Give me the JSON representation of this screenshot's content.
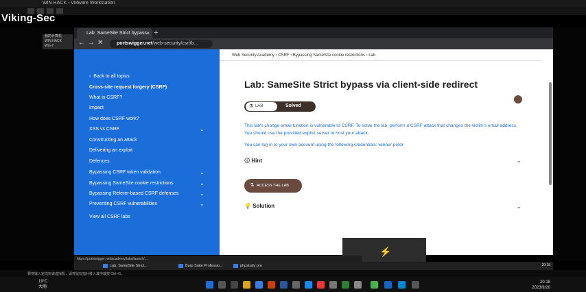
{
  "vm": {
    "title": "WIN HACK - VMware Workstation",
    "watermark": "Viking-Sec",
    "tree_items": [
      "我的计算机",
      "WIN HACK",
      "Win-7"
    ],
    "status_text": "要将输入定向到该虚拟机，请将鼠标指针移入其中或按 Ctrl+G。"
  },
  "browser": {
    "tab_title": "Lab: SameSite Strict bypass",
    "new_tab": "+",
    "close_tab": "×",
    "url_domain": "portswigger.net",
    "url_path": "/web-security/csrf/b…",
    "status_url": "https://portswigger.net/academy/labs/launch/..."
  },
  "sidebar": {
    "back": "Back to all topics",
    "items": [
      {
        "label": "Cross-site request forgery (CSRF)",
        "bold": true,
        "chev": false
      },
      {
        "label": "What is CSRF?",
        "bold": false,
        "chev": false
      },
      {
        "label": "Impact",
        "bold": false,
        "chev": false
      },
      {
        "label": "How does CSRF work?",
        "bold": false,
        "chev": false
      },
      {
        "label": "XSS vs CSRF",
        "bold": false,
        "chev": true
      },
      {
        "label": "Constructing an attack",
        "bold": false,
        "chev": false
      },
      {
        "label": "Delivering an exploit",
        "bold": false,
        "chev": false
      },
      {
        "label": "Defences",
        "bold": false,
        "chev": false
      },
      {
        "label": "Bypassing CSRF token validation",
        "bold": false,
        "chev": true
      },
      {
        "label": "Bypassing SameSite cookie restrictions",
        "bold": false,
        "chev": true
      },
      {
        "label": "Bypassing Referer-based CSRF defenses",
        "bold": false,
        "chev": true
      },
      {
        "label": "Preventing CSRF vulnerabilities",
        "bold": false,
        "chev": true
      },
      {
        "label": "View all CSRF labs",
        "bold": false,
        "chev": false
      }
    ]
  },
  "content": {
    "breadcrumbs": "Web Security Academy  ›  CSRF  ›  Bypassing SameSite cookie restrictions  ›  Lab",
    "title": "Lab: SameSite Strict bypass via client-side redirect",
    "badge_lab": "LAB",
    "badge_status": "Solved",
    "description": "This lab's change email function is vulnerable to CSRF. To solve the lab, perform a CSRF attack that changes the victim's email address. You should use the provided exploit server to host your attack.",
    "credentials_note": "You can log in to your own account using the following credentials: wiener:peter",
    "hint_label": "Hint",
    "access_button": "ACCESS THE LAB",
    "solution_label": "Solution"
  },
  "inner_taskbar": {
    "items": [
      "Lab: SameSite Strict...",
      "Burp Suite Professio...",
      "phpstudy pro"
    ],
    "time": "20:18"
  },
  "host": {
    "weather_temp": "19°C",
    "weather_desc": "大雨",
    "time": "20:18",
    "date": "2023/9/20"
  }
}
